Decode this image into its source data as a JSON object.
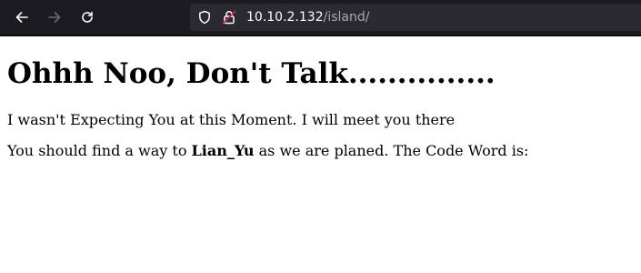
{
  "browser": {
    "back_icon": "arrow-left-icon",
    "forward_icon": "arrow-right-icon",
    "reload_icon": "reload-icon",
    "tracking_icon": "shield-icon",
    "security_icon": "insecure-lock-icon",
    "url_host": "10.10.2.132",
    "url_path": "/island/"
  },
  "page": {
    "heading": "Ohhh Noo, Don't Talk...............",
    "paragraph1": "I wasn't Expecting You at this Moment. I will meet you there",
    "paragraph2_before": "You should find a way to ",
    "paragraph2_bold": "Lian_Yu",
    "paragraph2_after": " as we are planed. The Code Word is:"
  },
  "colors": {
    "toolbar_bg": "#1c1b22",
    "urlbar_bg": "#2b2a33",
    "lock_accent": "#e22850",
    "page_bg": "#ffffff"
  }
}
